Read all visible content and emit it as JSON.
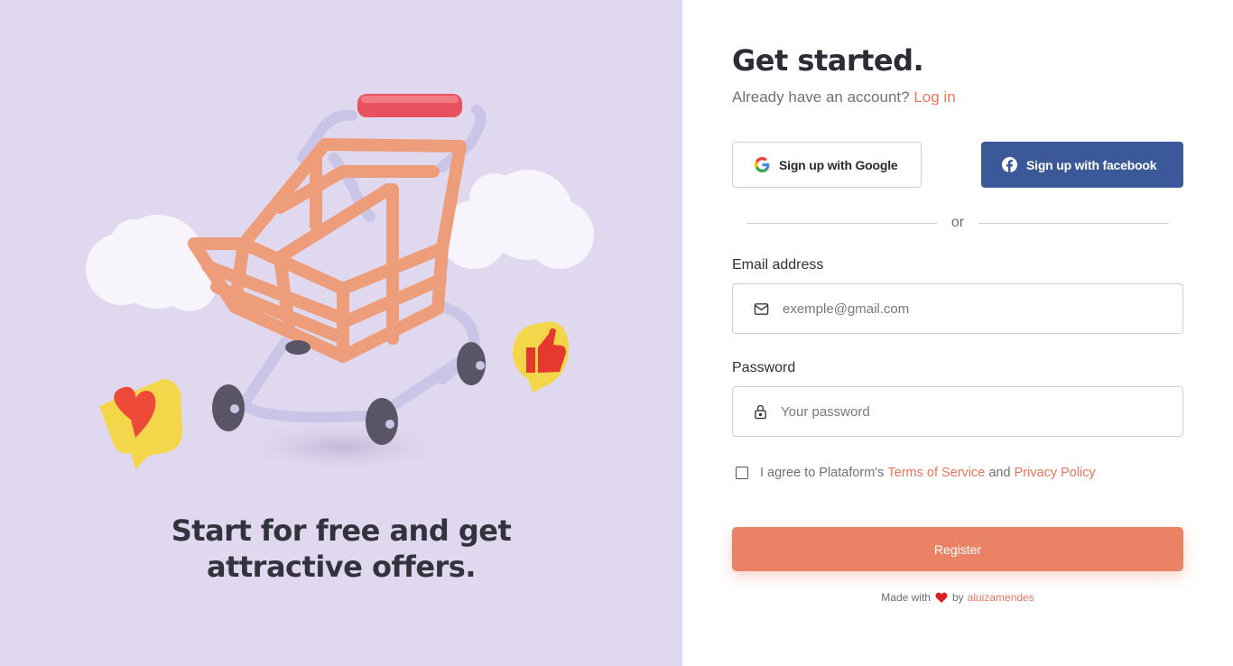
{
  "hero": {
    "tagline_line1": "Start for free and get",
    "tagline_line2": "attractive offers."
  },
  "form": {
    "title": "Get started.",
    "subtitle": "Already have an account?",
    "login_link": "Log in",
    "google_button": "Sign up with Google",
    "facebook_button": "Sign up with facebook",
    "divider_text": "or",
    "email": {
      "label": "Email address",
      "placeholder": "exemple@gmail.com",
      "value": ""
    },
    "password": {
      "label": "Password",
      "placeholder": "Your password",
      "value": ""
    },
    "terms": {
      "prefix": "I agree to Plataform's",
      "tos_link": "Terms of Service",
      "and": "and",
      "privacy_link": "Privacy Policy",
      "checked": false
    },
    "register_button": "Register"
  },
  "footer": {
    "made_with": "Made with",
    "by": "by",
    "author": "aluizamendes"
  },
  "icons": {
    "google": "google-icon",
    "facebook": "facebook-icon",
    "email": "mail-icon",
    "password": "lock-icon",
    "heart": "heart-icon"
  },
  "colors": {
    "accent": "#e8775a",
    "register_bg": "#ea8265",
    "facebook_bg": "#3b5998",
    "left_panel_bg": "#dfd8ef"
  }
}
